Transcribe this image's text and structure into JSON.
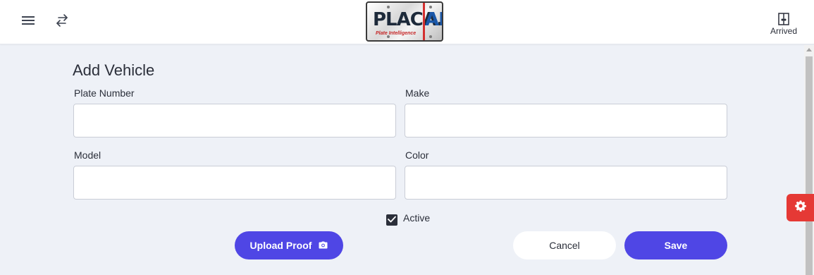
{
  "header": {
    "logo": {
      "text_left": "PLACA.",
      "text_right": "AI",
      "tagline": "Plate Intelligence"
    },
    "menu_icon": "hamburger-menu-icon",
    "swap_icon": "swap-arrows-icon",
    "arrived": {
      "label": "Arrived",
      "icon": "door-icon"
    }
  },
  "form": {
    "title": "Add Vehicle",
    "fields": {
      "plate_number": {
        "label": "Plate Number",
        "value": "",
        "placeholder": ""
      },
      "make": {
        "label": "Make",
        "value": "",
        "placeholder": ""
      },
      "model": {
        "label": "Model",
        "value": "",
        "placeholder": ""
      },
      "color": {
        "label": "Color",
        "value": "",
        "placeholder": ""
      }
    },
    "active": {
      "label": "Active",
      "checked": true
    },
    "buttons": {
      "upload_proof": "Upload Proof",
      "cancel": "Cancel",
      "save": "Save"
    }
  },
  "colors": {
    "primary": "#4f46e5",
    "settings_tab": "#e53935",
    "background": "#eef1f7"
  },
  "settings_tab_icon": "gear-icon"
}
